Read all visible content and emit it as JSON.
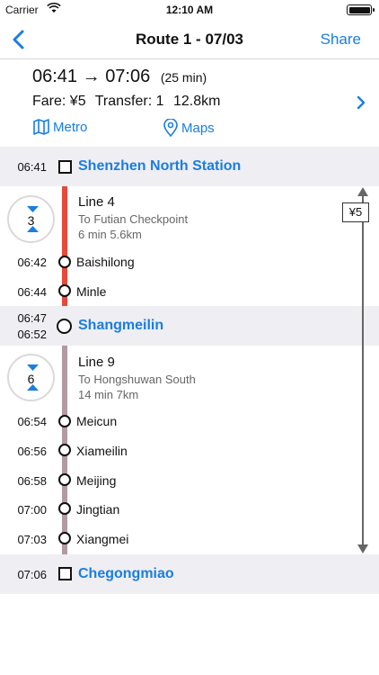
{
  "status_bar": {
    "carrier": "Carrier",
    "time": "12:10 AM"
  },
  "navbar": {
    "title": "Route 1 - 07/03",
    "share_label": "Share"
  },
  "summary": {
    "depart": "06:41",
    "arrow": "→",
    "arrive": "07:06",
    "duration": "(25 min)",
    "fare": "Fare: ¥5",
    "transfer": "Transfer: 1",
    "distance": "12.8km",
    "links": {
      "metro": "Metro",
      "maps": "Maps"
    }
  },
  "route": {
    "start": {
      "time": "06:41",
      "name": "Shenzhen North Station"
    },
    "legs": [
      {
        "line": "Line 4",
        "direction": "To Futian Checkpoint",
        "meta": "6 min 5.6km",
        "stop_count": "3",
        "color": "#e64a3a",
        "stops": [
          {
            "time": "06:42",
            "name": "Baishilong"
          },
          {
            "time": "06:44",
            "name": "Minle"
          }
        ]
      },
      {
        "line": "Line 9",
        "direction": "To Hongshuwan South",
        "meta": "14 min 7km",
        "stop_count": "6",
        "color": "#b39aa1",
        "stops": [
          {
            "time": "06:54",
            "name": "Meicun"
          },
          {
            "time": "06:56",
            "name": "Xiameilin"
          },
          {
            "time": "06:58",
            "name": "Meijing"
          },
          {
            "time": "07:00",
            "name": "Jingtian"
          },
          {
            "time": "07:03",
            "name": "Xiangmei"
          }
        ]
      }
    ],
    "transfer": {
      "arrive_time": "06:47",
      "depart_time": "06:52",
      "name": "Shangmeilin"
    },
    "end": {
      "time": "07:06",
      "name": "Chegongmiao"
    },
    "fare_tag": "¥5"
  },
  "colors": {
    "accent": "#1a7ee0",
    "band": "#eeeef3"
  }
}
